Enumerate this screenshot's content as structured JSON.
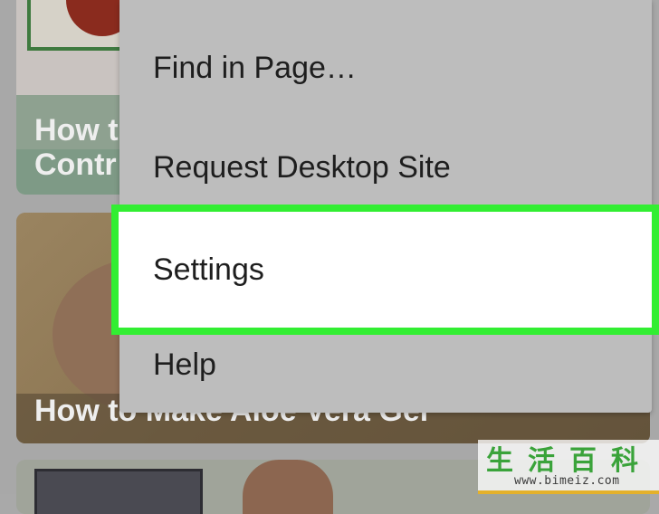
{
  "background": {
    "cards": [
      {
        "title_line1": "How t",
        "title_line2": "Contr"
      },
      {
        "title": "How to Make Aloe Vera Gel"
      }
    ]
  },
  "menu": {
    "items": [
      {
        "label": "Find in Page…"
      },
      {
        "label": "Request Desktop Site"
      },
      {
        "label": "Settings",
        "highlighted": true
      },
      {
        "label": "Help"
      }
    ]
  },
  "watermark": {
    "chars": [
      "生",
      "活",
      "百",
      "科"
    ],
    "url": "www.bimeiz.com"
  },
  "colors": {
    "highlight_border": "#32ee32",
    "menu_bg": "#bdbdbd",
    "dim_bg": "#a8a8a8"
  }
}
